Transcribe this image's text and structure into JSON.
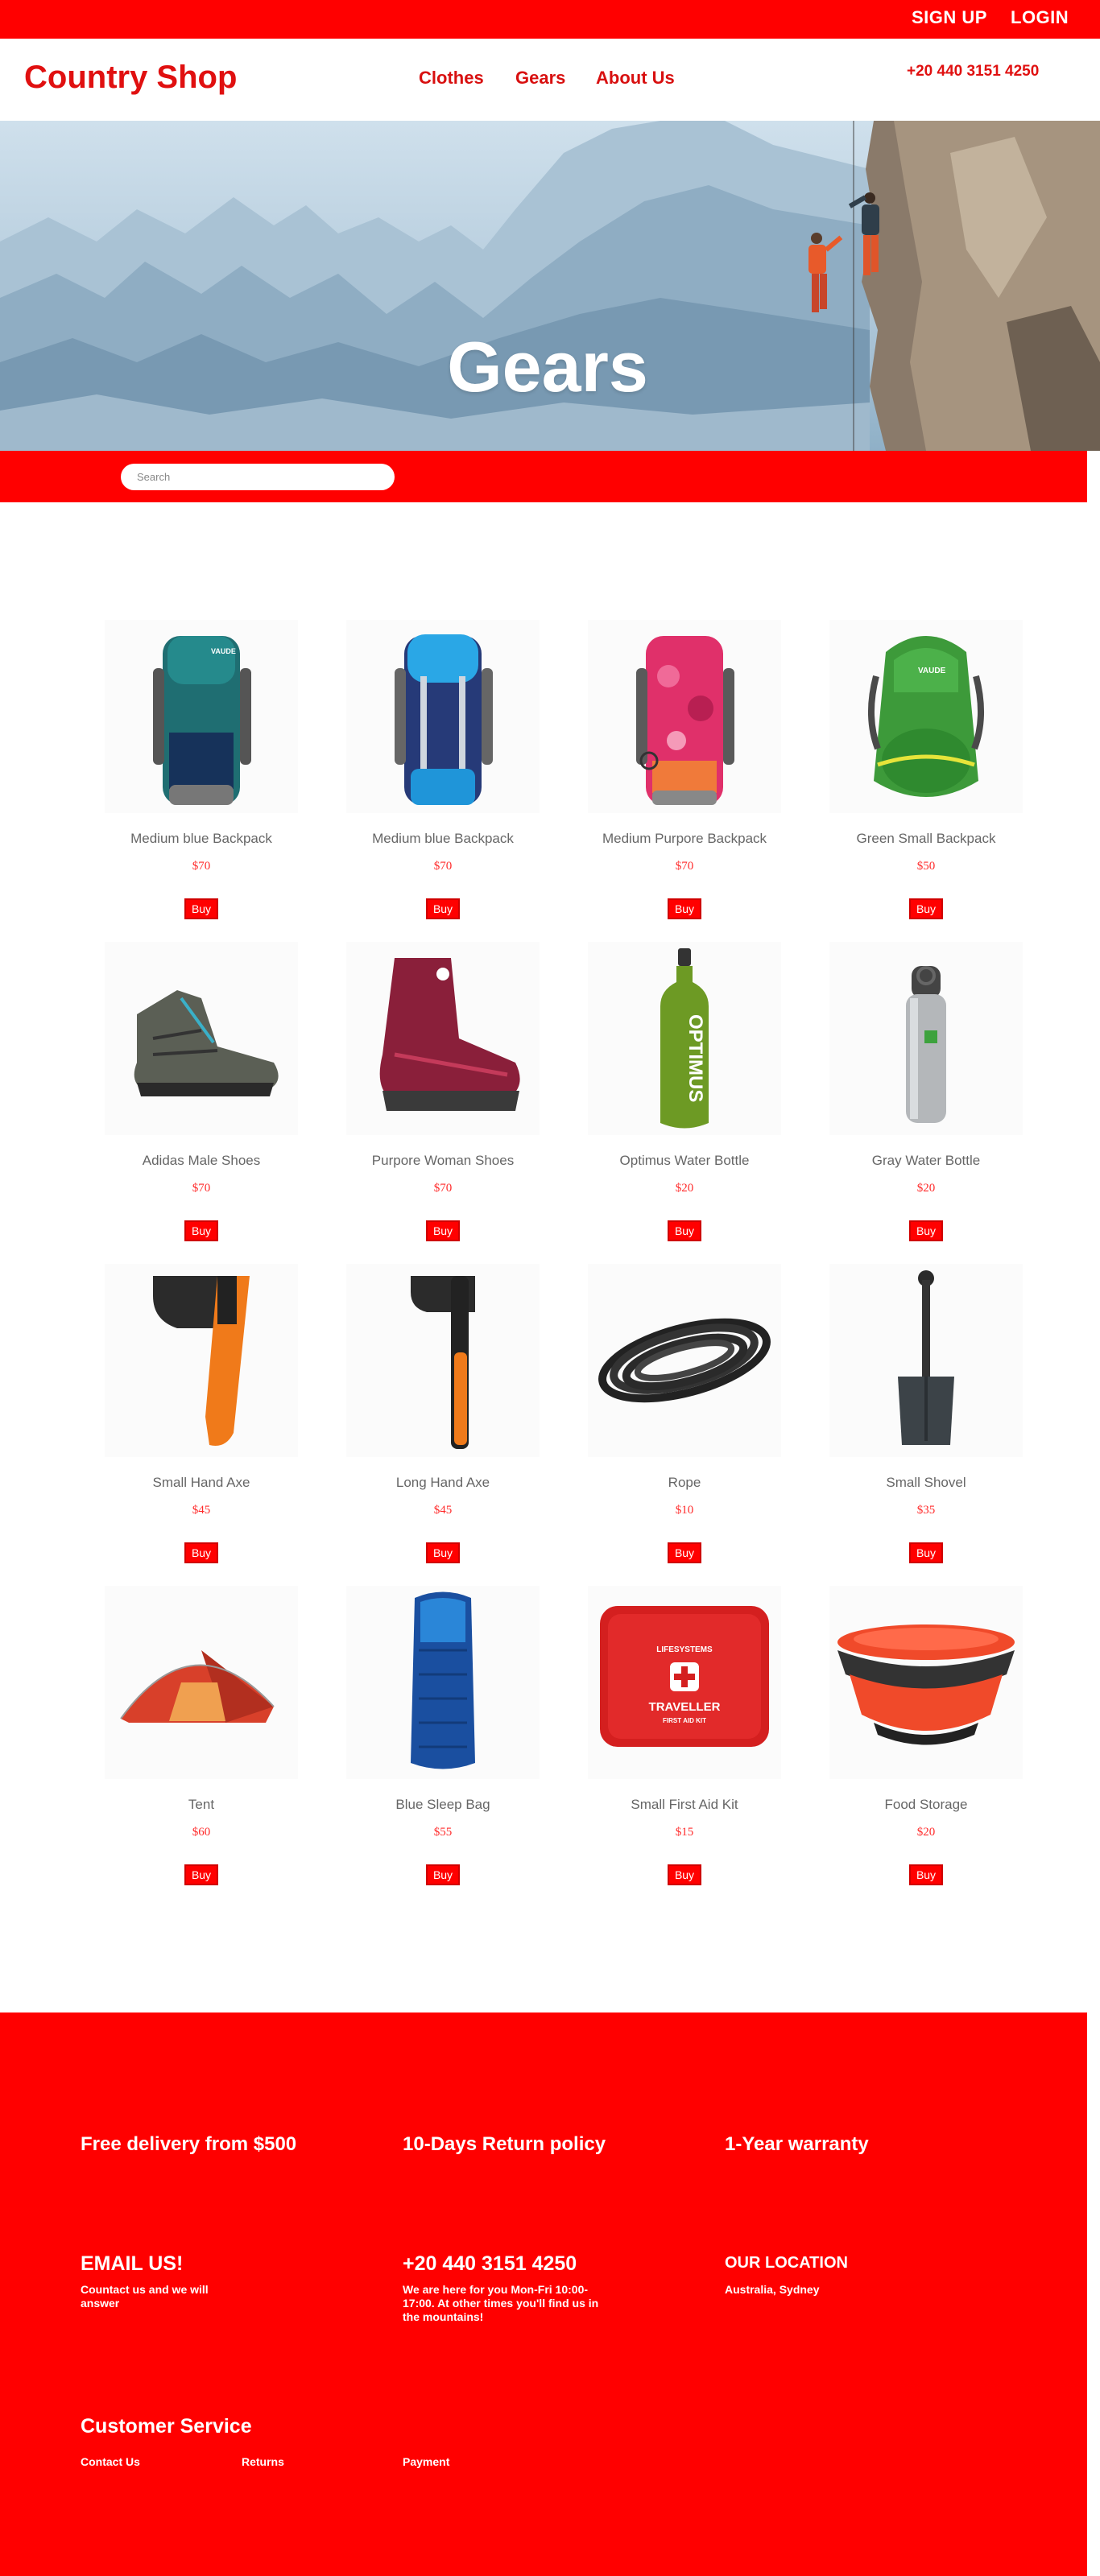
{
  "topbar": {
    "signup": "SIGN UP",
    "login": "LOGIN"
  },
  "nav": {
    "logo": "Country Shop",
    "links": [
      "Clothes",
      "Gears",
      "About Us"
    ],
    "phone": "+20 440 3151 4250"
  },
  "hero": {
    "title": "Gears"
  },
  "search": {
    "placeholder": "Search"
  },
  "buy_label": "Buy",
  "products": [
    {
      "name": "Medium blue Backpack",
      "price": "$70"
    },
    {
      "name": "Medium blue Backpack",
      "price": "$70"
    },
    {
      "name": "Medium Purpore Backpack",
      "price": "$70"
    },
    {
      "name": "Green Small Backpack",
      "price": "$50"
    },
    {
      "name": "Adidas Male Shoes",
      "price": "$70"
    },
    {
      "name": "Purpore Woman Shoes",
      "price": "$70"
    },
    {
      "name": "Optimus Water Bottle",
      "price": "$20"
    },
    {
      "name": "Gray Water Bottle",
      "price": "$20"
    },
    {
      "name": "Small Hand Axe",
      "price": "$45"
    },
    {
      "name": "Long Hand Axe",
      "price": "$45"
    },
    {
      "name": "Rope",
      "price": "$10"
    },
    {
      "name": "Small Shovel",
      "price": "$35"
    },
    {
      "name": "Tent",
      "price": "$60"
    },
    {
      "name": "Blue Sleep Bag",
      "price": "$55"
    },
    {
      "name": "Small First Aid Kit",
      "price": "$15"
    },
    {
      "name": "Food Storage",
      "price": "$20"
    }
  ],
  "product_image_text": {
    "backpack_brand": "VAUDE",
    "bottle_brand": "OPTIMUS",
    "firstaid_brand": "LIFESYSTEMS",
    "firstaid_title": "TRAVELLER",
    "firstaid_sub": "FIRST AID KIT"
  },
  "footer": {
    "perks": [
      "Free delivery from $500",
      "10-Days Return policy",
      "1-Year warranty"
    ],
    "email_title": "EMAIL US!",
    "email_text": "Countact us and we will answer",
    "phone_title": "+20 440 3151 4250",
    "phone_text": "We are here for you Mon-Fri 10:00-17:00. At other times you'll find us in the mountains!",
    "location_title": "OUR LOCATION",
    "location_text": "Australia, Sydney",
    "service_title": "Customer Service",
    "service_links": [
      "Contact Us",
      "Returns",
      "Payment"
    ]
  },
  "colors": {
    "brand_red": "#ff0000",
    "logo_red": "#e01010",
    "price_red": "#ff2a2a"
  }
}
